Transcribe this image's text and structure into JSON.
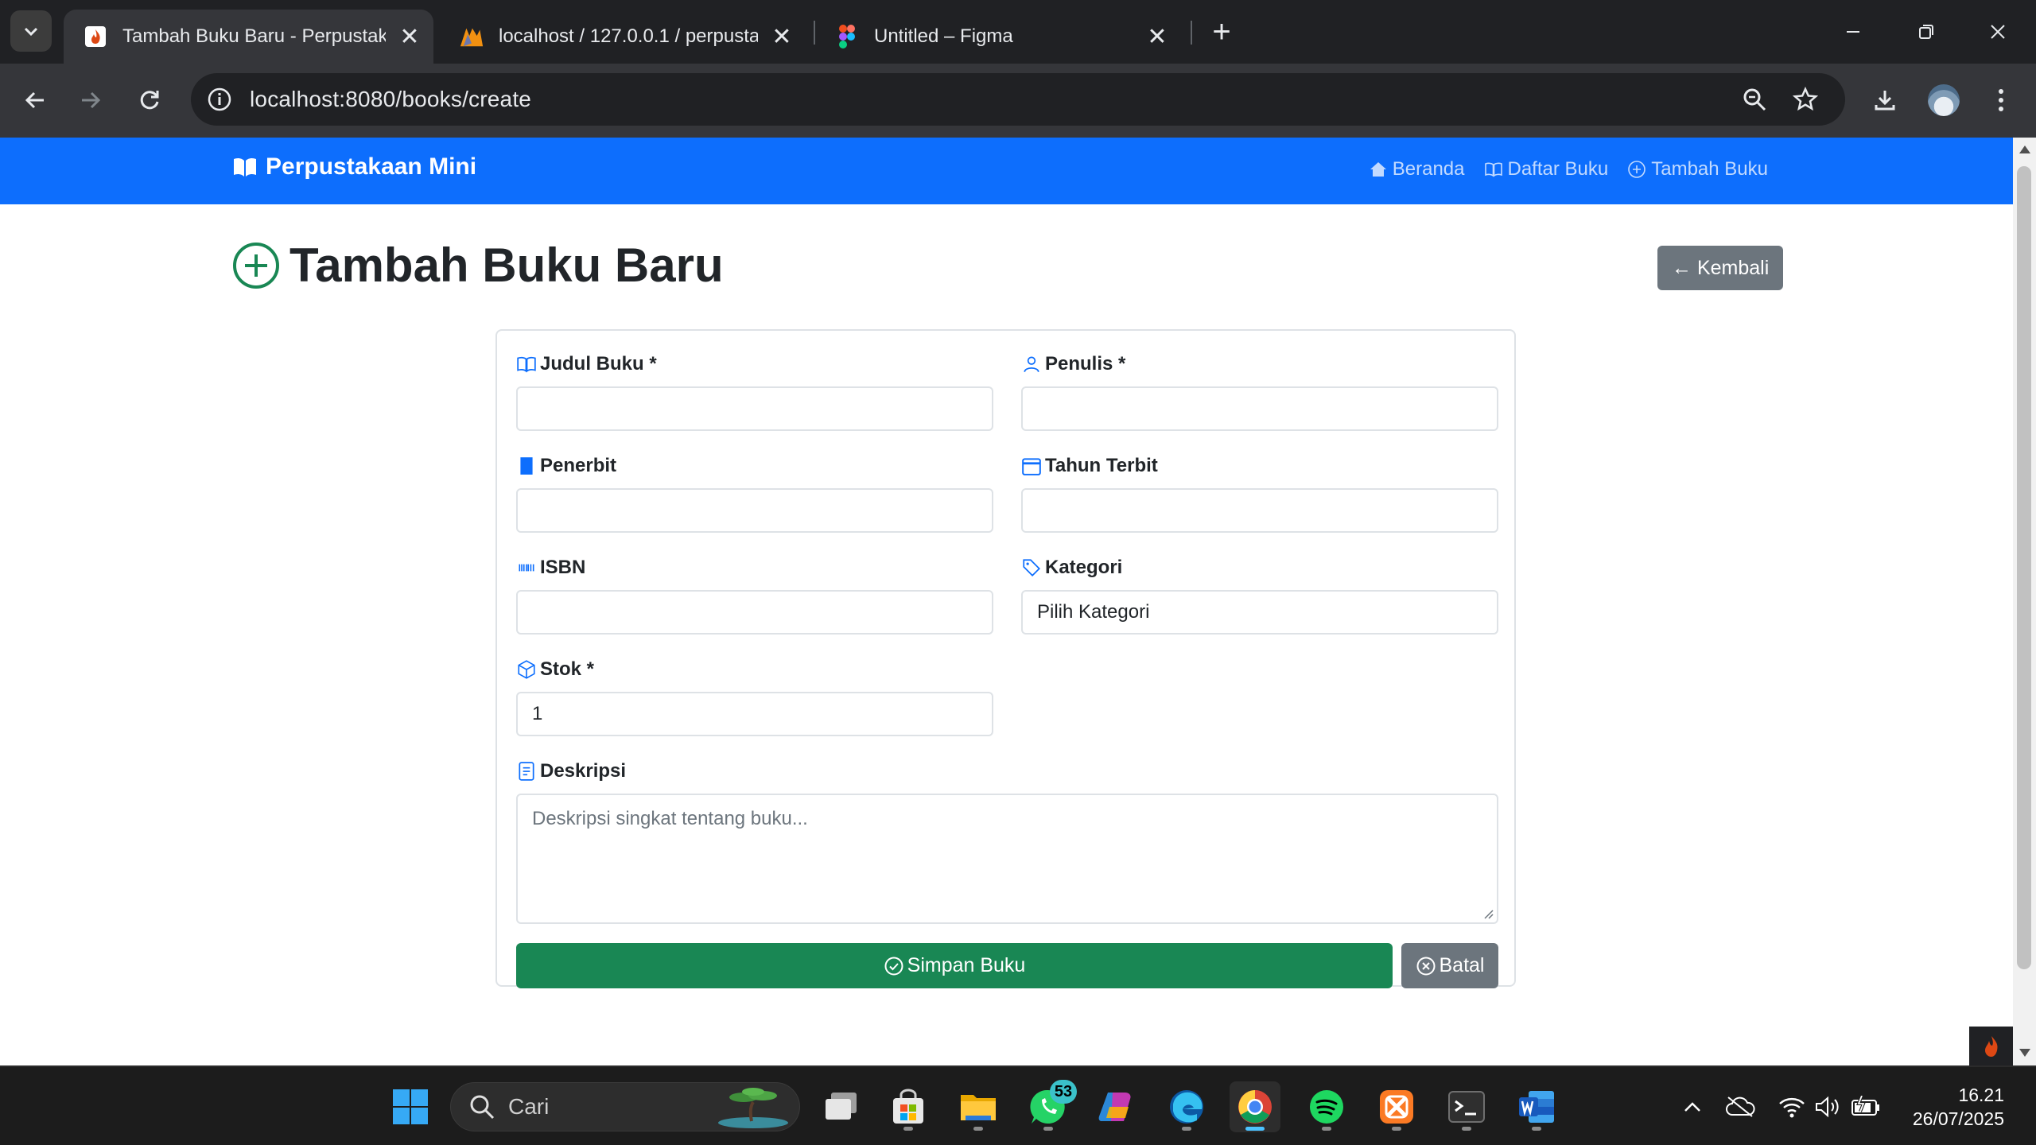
{
  "browser": {
    "tabs": [
      {
        "title": "Tambah Buku Baru - Perpustakaan Mini",
        "active": true,
        "favicon": "flame-icon"
      },
      {
        "title": "localhost / 127.0.0.1 / perpustakaan",
        "active": false,
        "favicon": "phpmyadmin-icon"
      },
      {
        "title": "Untitled – Figma",
        "active": false,
        "favicon": "figma-icon"
      }
    ],
    "url": "localhost:8080/books/create"
  },
  "app": {
    "brand": "Perpustakaan Mini",
    "nav": [
      {
        "label": "Beranda",
        "icon": "house-icon"
      },
      {
        "label": "Daftar Buku",
        "icon": "book-icon"
      },
      {
        "label": "Tambah Buku",
        "icon": "plus-circle-icon"
      }
    ],
    "page_title": "Tambah Buku Baru",
    "back_button": "← Kembali"
  },
  "form": {
    "fields": {
      "judul": {
        "label": "Judul Buku *",
        "value": "",
        "icon": "book-icon"
      },
      "penulis": {
        "label": "Penulis *",
        "value": "",
        "icon": "person-icon"
      },
      "penerbit": {
        "label": "Penerbit",
        "value": "",
        "icon": "bookmark-icon"
      },
      "tahun": {
        "label": "Tahun Terbit",
        "value": "",
        "icon": "calendar-icon"
      },
      "isbn": {
        "label": "ISBN",
        "value": "",
        "icon": "barcode-icon"
      },
      "kategori": {
        "label": "Kategori",
        "value": "Pilih Kategori",
        "icon": "tag-icon"
      },
      "stok": {
        "label": "Stok *",
        "value": "1",
        "icon": "box-icon"
      },
      "deskripsi": {
        "label": "Deskripsi",
        "placeholder": "Deskripsi singkat tentang buku...",
        "icon": "file-text-icon"
      }
    },
    "save_button": "Simpan Buku",
    "cancel_button": "Batal"
  },
  "taskbar": {
    "search_placeholder": "Cari",
    "whatsapp_badge": "53",
    "time": "16.21",
    "date": "26/07/2025"
  },
  "colors": {
    "primary": "#0d6efd",
    "success": "#198754",
    "secondary": "#6c757d"
  }
}
